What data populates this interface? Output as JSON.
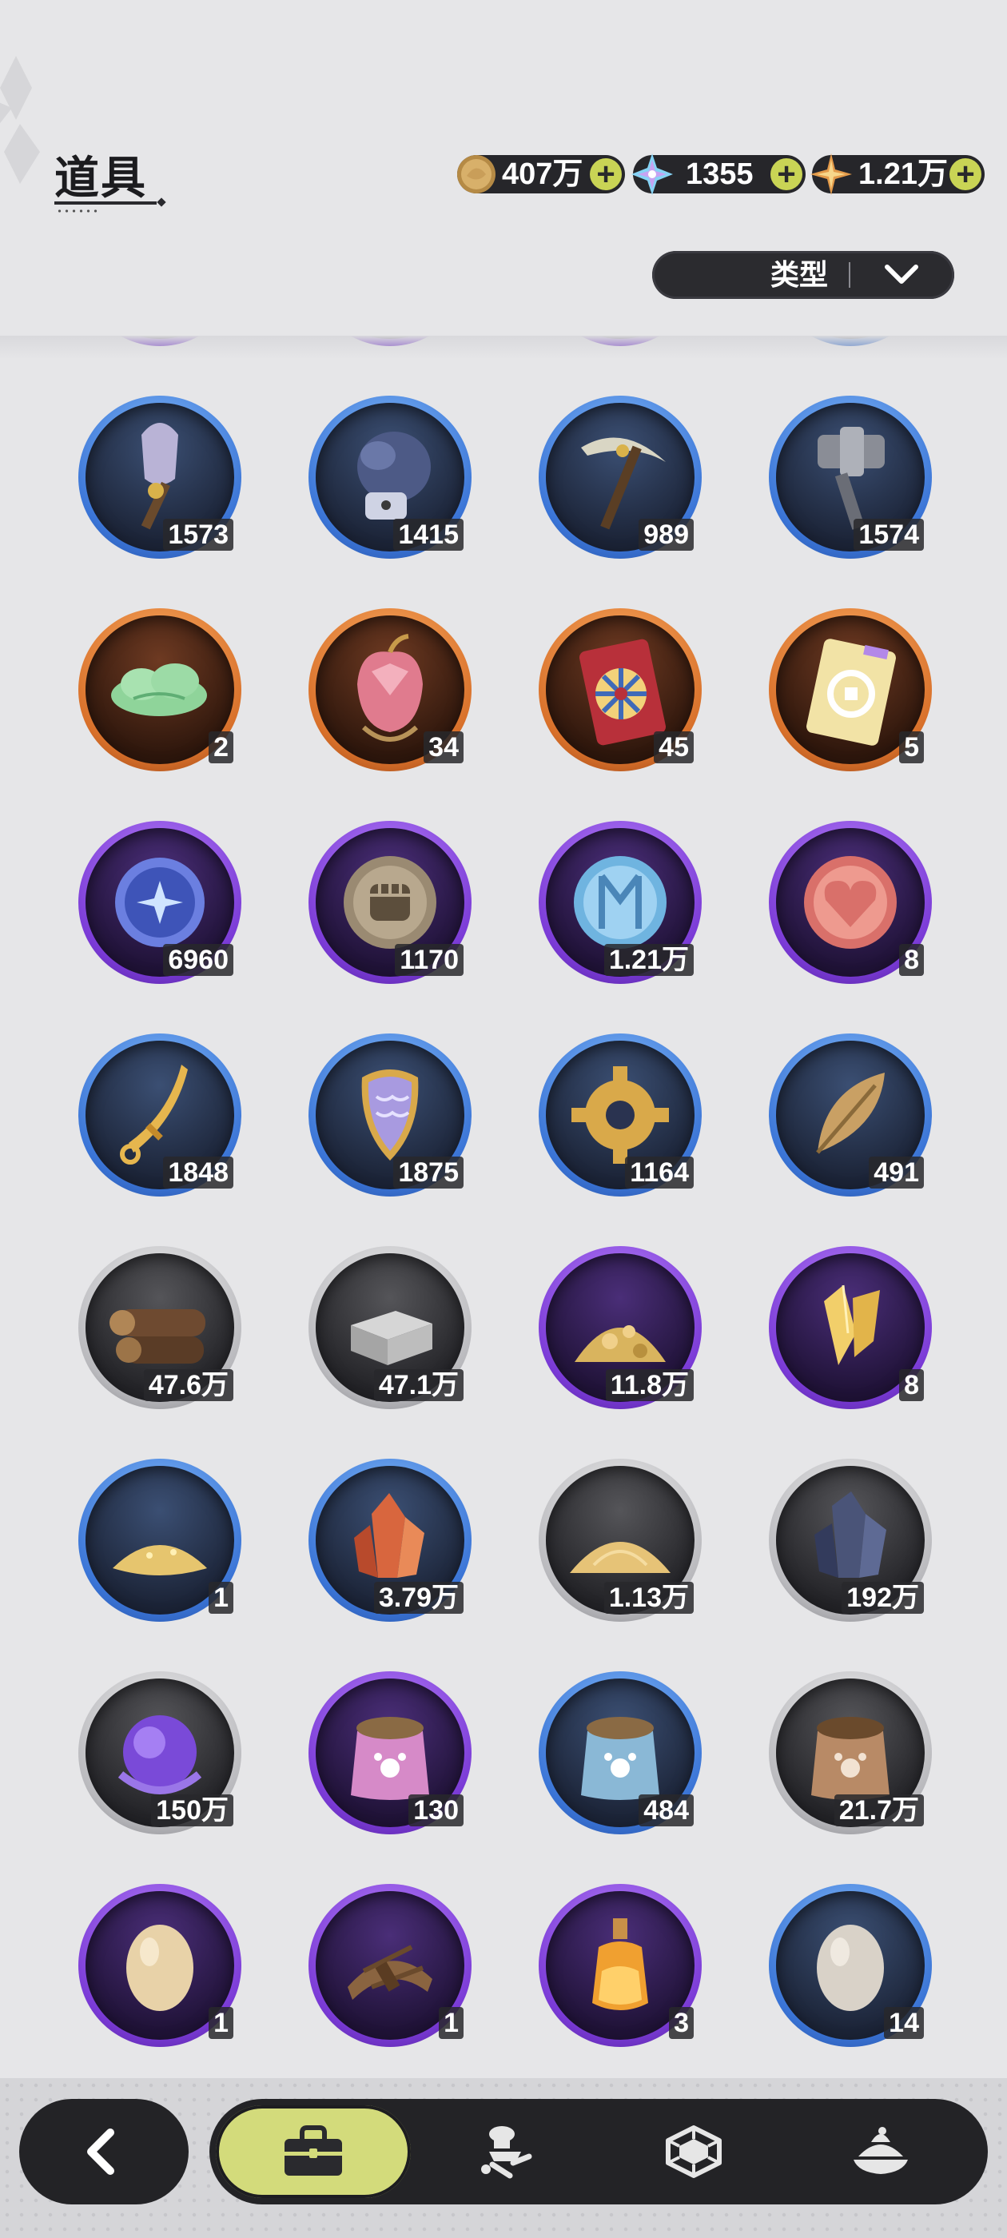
{
  "header": {
    "title": "道具"
  },
  "currencies": [
    {
      "name": "gold-coin",
      "value": "407万",
      "color": "#c9a15a"
    },
    {
      "name": "crystal",
      "value": "1355",
      "color": "#7ec8f0"
    },
    {
      "name": "star-shard",
      "value": "1.21万",
      "color": "#e0a060"
    }
  ],
  "filter": {
    "label": "类型"
  },
  "items": [
    {
      "icon": "shovel-icon",
      "rarity": "blue",
      "count": "1573"
    },
    {
      "icon": "boxing-glove-icon",
      "rarity": "blue",
      "count": "1415"
    },
    {
      "icon": "pickaxe-icon",
      "rarity": "blue",
      "count": "989"
    },
    {
      "icon": "hammer-icon",
      "rarity": "blue",
      "count": "1574"
    },
    {
      "icon": "green-cloud-icon",
      "rarity": "orange",
      "count": "2"
    },
    {
      "icon": "crystal-apple-icon",
      "rarity": "orange",
      "count": "34"
    },
    {
      "icon": "wheel-ticket-icon",
      "rarity": "orange",
      "count": "45"
    },
    {
      "icon": "puzzle-ticket-icon",
      "rarity": "orange",
      "count": "5"
    },
    {
      "icon": "moon-star-coin-icon",
      "rarity": "purple",
      "count": "6960"
    },
    {
      "icon": "fist-coin-icon",
      "rarity": "purple",
      "count": "1170"
    },
    {
      "icon": "blue-emblem-coin-icon",
      "rarity": "purple",
      "count": "1.21万"
    },
    {
      "icon": "heart-coin-icon",
      "rarity": "purple",
      "count": "8"
    },
    {
      "icon": "golden-blade-icon",
      "rarity": "blue",
      "count": "1848"
    },
    {
      "icon": "scale-shield-icon",
      "rarity": "blue",
      "count": "1875"
    },
    {
      "icon": "gear-icon",
      "rarity": "blue",
      "count": "1164"
    },
    {
      "icon": "golden-leaf-icon",
      "rarity": "blue",
      "count": "491"
    },
    {
      "icon": "wood-logs-icon",
      "rarity": "gray",
      "count": "47.6万"
    },
    {
      "icon": "stone-bricks-icon",
      "rarity": "gray",
      "count": "47.1万"
    },
    {
      "icon": "gold-ore-pile-icon",
      "rarity": "purple",
      "count": "11.8万"
    },
    {
      "icon": "gold-crystal-icon",
      "rarity": "purple",
      "count": "8"
    },
    {
      "icon": "gold-dust-icon",
      "rarity": "blue",
      "count": "1"
    },
    {
      "icon": "red-crystal-icon",
      "rarity": "blue",
      "count": "3.79万"
    },
    {
      "icon": "sand-pile-icon",
      "rarity": "gray",
      "count": "1.13万"
    },
    {
      "icon": "dark-crystal-icon",
      "rarity": "gray",
      "count": "192万"
    },
    {
      "icon": "purple-orb-icon",
      "rarity": "gray",
      "count": "150万"
    },
    {
      "icon": "pink-food-bag-icon",
      "rarity": "purple",
      "count": "130"
    },
    {
      "icon": "blue-food-bag-icon",
      "rarity": "blue",
      "count": "484"
    },
    {
      "icon": "brown-food-bag-icon",
      "rarity": "gray",
      "count": "21.7万"
    },
    {
      "icon": "egg-icon",
      "rarity": "purple",
      "count": "1"
    },
    {
      "icon": "straw-bundle-icon",
      "rarity": "purple",
      "count": "1"
    },
    {
      "icon": "potion-bottle-icon",
      "rarity": "purple",
      "count": "3"
    },
    {
      "icon": "gray-egg-icon",
      "rarity": "blue",
      "count": "14"
    }
  ],
  "partial_row_rarities": [
    "purple",
    "purple",
    "purple",
    "blue"
  ],
  "nav": {
    "tabs": [
      {
        "icon": "bag-icon",
        "active": true
      },
      {
        "icon": "chef-tools-icon",
        "active": false
      },
      {
        "icon": "hexagon-gem-icon",
        "active": false
      },
      {
        "icon": "food-dish-icon",
        "active": false
      }
    ]
  }
}
